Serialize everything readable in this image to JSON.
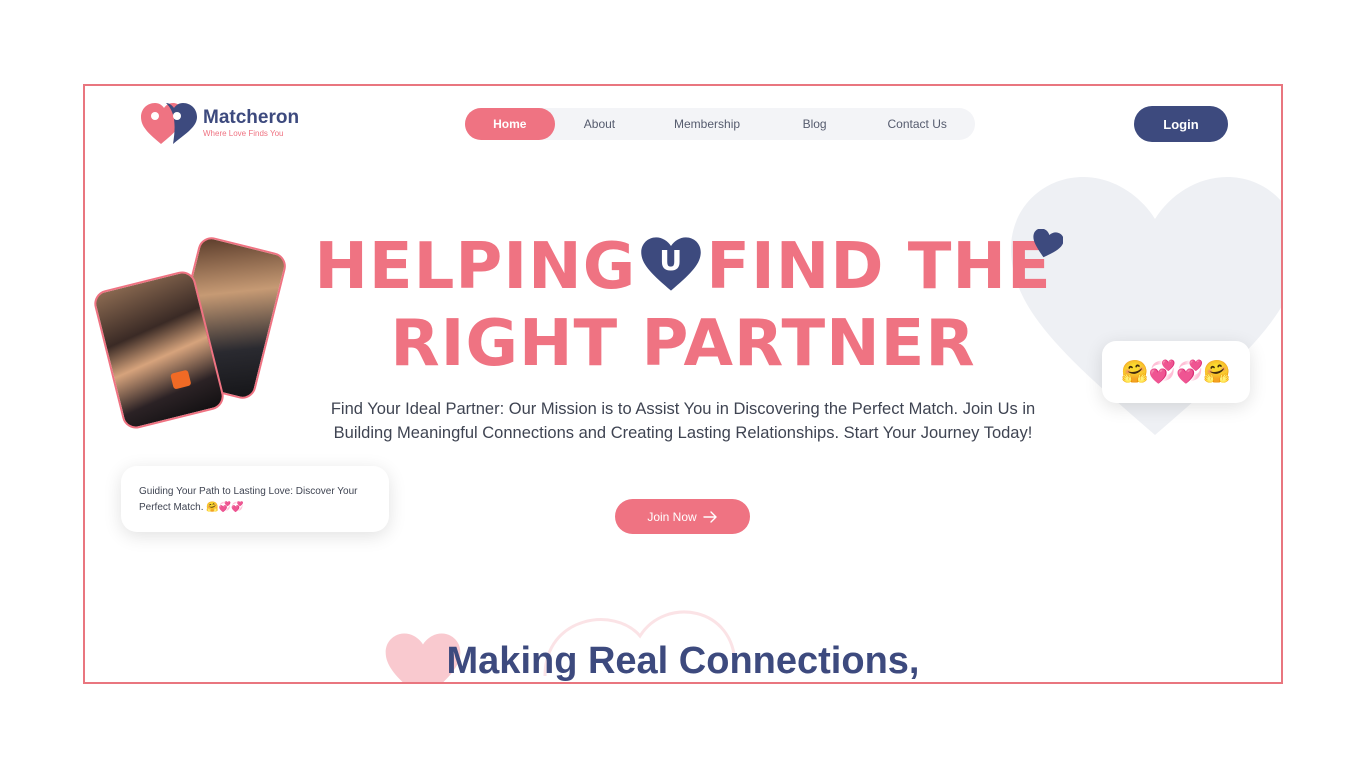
{
  "brand": {
    "name": "Matcheron",
    "tagline": "Where Love Finds You"
  },
  "nav": {
    "items": [
      {
        "label": "Home",
        "active": true
      },
      {
        "label": "About",
        "active": false
      },
      {
        "label": "Membership",
        "active": false
      },
      {
        "label": "Blog",
        "active": false
      },
      {
        "label": "Contact Us",
        "active": false
      }
    ]
  },
  "header": {
    "login_label": "Login"
  },
  "hero": {
    "headline_part1": "HELPING",
    "headline_heart_letter": "U",
    "headline_part2": "FIND THE",
    "headline_line2": "RIGHT PARTNER",
    "subtitle": "Find Your Ideal Partner: Our Mission is to Assist You in Discovering the Perfect Match. Join Us in Building Meaningful Connections and Creating Lasting Relationships. Start Your Journey Today!",
    "cta_label": "Join Now",
    "card_left_text": "Guiding Your Path to Lasting Love: Discover Your Perfect Match. 🤗💞💞",
    "card_right_emojis": "🤗💞💞🤗"
  },
  "section": {
    "title": "Making Real Connections,"
  },
  "colors": {
    "pink": "#ef7382",
    "navy": "#3d4a7e",
    "nav_bg": "#f3f4f7"
  }
}
